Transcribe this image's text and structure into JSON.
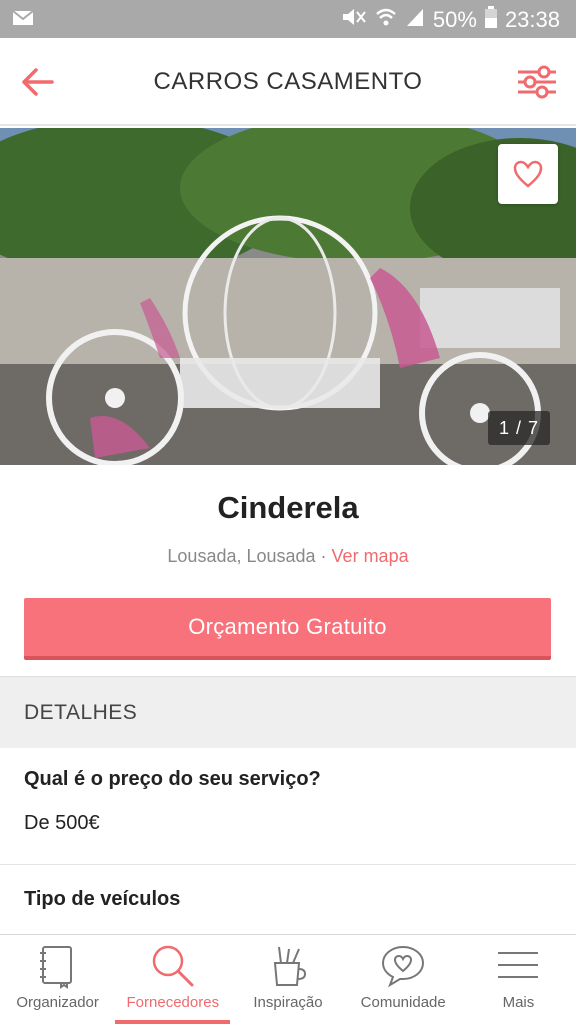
{
  "status_bar": {
    "battery": "50%",
    "time": "23:38"
  },
  "header": {
    "title": "CARROS CASAMENTO"
  },
  "gallery": {
    "counter": "1 / 7"
  },
  "vendor": {
    "name": "Cinderela",
    "location": "Lousada, Lousada",
    "separator": " · ",
    "map_link": "Ver mapa",
    "cta_label": "Orçamento Gratuito"
  },
  "details": {
    "heading": "DETALHES",
    "price_question": "Qual é o preço do seu serviço?",
    "price_answer": "De 500€",
    "vehicle_question": "Tipo de veículos"
  },
  "nav": {
    "items": [
      {
        "label": "Organizador",
        "icon": "notebook-icon"
      },
      {
        "label": "Fornecedores",
        "icon": "search-icon",
        "active": true
      },
      {
        "label": "Inspiração",
        "icon": "brush-cup-icon"
      },
      {
        "label": "Comunidade",
        "icon": "chat-heart-icon"
      },
      {
        "label": "Mais",
        "icon": "menu-icon"
      }
    ]
  },
  "colors": {
    "accent": "#f06a6e",
    "cta": "#f7727a",
    "status_bar": "#a9a9a9"
  }
}
